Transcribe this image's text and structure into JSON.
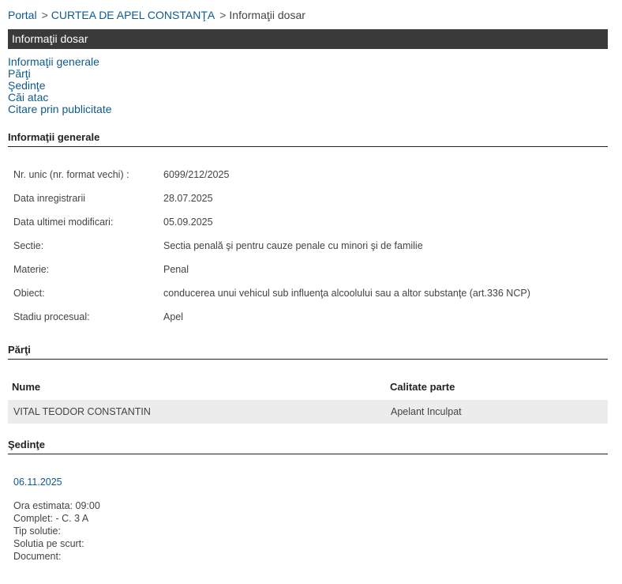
{
  "breadcrumb": {
    "portal": "Portal",
    "court": "CURTEA DE APEL CONSTANŢA",
    "current": "Informaţii dosar",
    "separator": ">"
  },
  "title": "Informaţii dosar",
  "toc": {
    "items": [
      "Informaţii generale",
      "Părţi",
      "Şedinţe",
      "Căi atac",
      "Citare prin publicitate"
    ]
  },
  "general": {
    "heading": "Informaţii generale",
    "rows": [
      {
        "label": "Nr. unic (nr. format vechi) :",
        "value": "6099/212/2025"
      },
      {
        "label": "Data inregistrarii",
        "value": "28.07.2025"
      },
      {
        "label": "Data ultimei modificari:",
        "value": "05.09.2025"
      },
      {
        "label": "Sectie:",
        "value": "Sectia penală şi pentru cauze penale cu minori şi de familie"
      },
      {
        "label": "Materie:",
        "value": "Penal"
      },
      {
        "label": "Obiect:",
        "value": "conducerea unui vehicul sub influenţa alcoolului sau a altor substanţe (art.336 NCP)"
      },
      {
        "label": "Stadiu procesual:",
        "value": "Apel"
      }
    ]
  },
  "parti": {
    "heading": "Părţi",
    "columns": [
      "Nume",
      "Calitate parte"
    ],
    "rows": [
      {
        "nume": "VITAL TEODOR CONSTANTIN",
        "calitate": "Apelant Inculpat"
      }
    ]
  },
  "sedinte": {
    "heading": "Şedinţe",
    "date": "06.11.2025",
    "lines": [
      "Ora estimata: 09:00",
      "Complet: - C. 3 A",
      "Tip solutie:",
      "Solutia pe scurt:",
      "Document:"
    ]
  }
}
